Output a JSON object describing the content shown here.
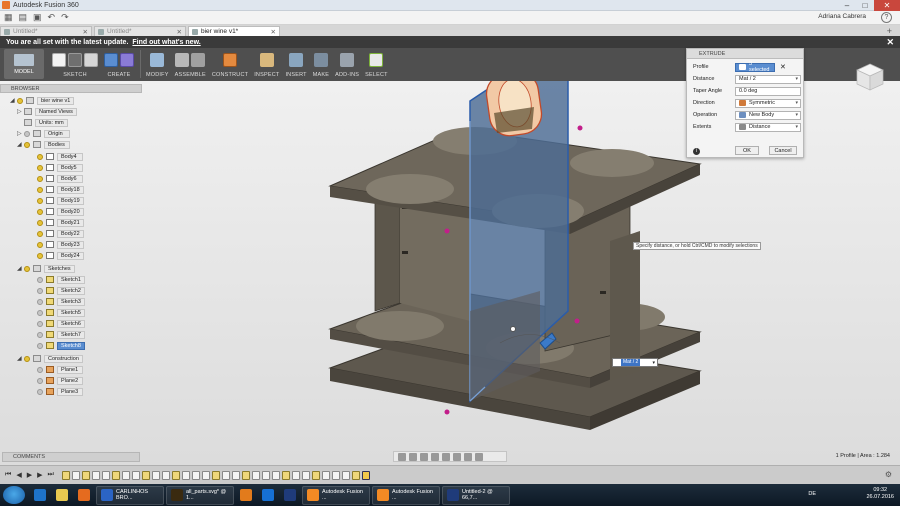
{
  "window": {
    "title": "Autodesk Fusion 360"
  },
  "quickbar": {
    "user": "Adriana Cabrera",
    "help": "?"
  },
  "tabs": [
    {
      "label": "Untitled*",
      "active": false
    },
    {
      "label": "Untitled*",
      "active": false
    },
    {
      "label": "bier wine v1*",
      "active": true
    }
  ],
  "banner": {
    "text": "You are all set with the latest update.",
    "link": "Find out what's new."
  },
  "ribbon": {
    "model": "MODEL",
    "groups": [
      "SKETCH",
      "CREATE",
      "MODIFY",
      "ASSEMBLE",
      "CONSTRUCT",
      "INSPECT",
      "INSERT",
      "MAKE",
      "ADD-INS",
      "SELECT"
    ]
  },
  "browser": {
    "title": "BROWSER",
    "root": "bier wine v1",
    "named_views": "Named Views",
    "units": "Units: mm",
    "origin": "Origin",
    "bodies": "Bodies",
    "body_items": [
      "Body4",
      "Body5",
      "Body6",
      "Body18",
      "Body19",
      "Body20",
      "Body21",
      "Body22",
      "Body23",
      "Body24"
    ],
    "sketches": "Sketches",
    "sketch_items": [
      "Sketch1",
      "Sketch2",
      "Sketch3",
      "Sketch5",
      "Sketch6",
      "Sketch7",
      "Sketch8"
    ],
    "construction": "Construction",
    "plane_items": [
      "Plane1",
      "Plane2",
      "Plane3"
    ]
  },
  "comments": "COMMENTS",
  "extrude": {
    "title": "EXTRUDE",
    "profile_label": "Profile",
    "profile_value": "3 selected",
    "distance_label": "Distance",
    "distance_value": "Mat / 2",
    "taper_label": "Taper Angle",
    "taper_value": "0.0 deg",
    "direction_label": "Direction",
    "direction_value": "Symmetric",
    "operation_label": "Operation",
    "operation_value": "New Body",
    "extents_label": "Extents",
    "extents_value": "Distance",
    "ok": "OK",
    "cancel": "Cancel"
  },
  "tooltip": "Specify distance, or hold Ctrl/CMD to modify selections",
  "distance_input": "Mat / 2",
  "status": "1 Profile | Area : 1.284",
  "taskbar": {
    "items": [
      {
        "label": "",
        "color": "#1e73c9"
      },
      {
        "label": "",
        "color": "#e8c850"
      },
      {
        "label": "",
        "color": "#e56b1f"
      },
      {
        "label": "CARLINHOS BRO...",
        "color": "#2b64c4"
      },
      {
        "label": "all_parts.svg* @ 1...",
        "color": "#3a2a10"
      },
      {
        "label": "",
        "color": "#e27b1c"
      },
      {
        "label": "",
        "color": "#1670d4"
      },
      {
        "label": "",
        "color": "#1f3b7a"
      },
      {
        "label": "Autodesk Fusion ...",
        "color": "#f28a24"
      },
      {
        "label": "Autodesk Fusion ...",
        "color": "#f28a24"
      },
      {
        "label": "Untitled-2 @ 66,7...",
        "color": "#1f3b7a"
      }
    ],
    "lang": "DE",
    "time": "09:32",
    "date": "26.07.2016"
  },
  "colors": {
    "ribbon": "#4f4f4f",
    "selection": "#5a8dd0",
    "body": "#6b6458",
    "extrude_plane": "#4d6c95"
  }
}
